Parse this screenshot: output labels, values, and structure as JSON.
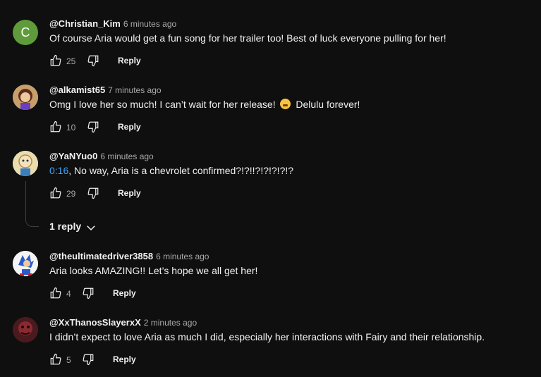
{
  "colors": {
    "background": "#0f0f0f",
    "text": "#f1f1f1",
    "muted": "#aaaaaa",
    "timestamp_link": "#3ea6ff"
  },
  "comments": [
    {
      "author": "@Christian_Kim",
      "time": "6 minutes ago",
      "avatar_letter": "C",
      "text": "Of course Aria would get a fun song for her trailer too! Best of luck everyone pulling for her!",
      "likes": "25",
      "reply_label": "Reply"
    },
    {
      "author": "@alkamist65",
      "time": "7 minutes ago",
      "text_before": "Omg I love her so much! I can’t wait for her release!",
      "emoji": "loudly-crying-face",
      "text_after": "Delulu forever!",
      "likes": "10",
      "reply_label": "Reply"
    },
    {
      "author": "@YaNYuo0",
      "time": "6 minutes ago",
      "timestamp": "0:16",
      "text": ", No way, Aria is a chevrolet confirmed?!?!!?!?!?!?!?",
      "likes": "29",
      "reply_label": "Reply",
      "replies_toggle": "1 reply"
    },
    {
      "author": "@theultimatedriver3858",
      "time": "6 minutes ago",
      "text": "Aria looks AMAZING!! Let’s hope we all get her!",
      "likes": "4",
      "reply_label": "Reply"
    },
    {
      "author": "@XxThanosSlayerxX",
      "time": "2 minutes ago",
      "text": "I didn’t expect to love Aria as much I did, especially her interactions with Fairy and their relationship.",
      "likes": "5",
      "reply_label": "Reply"
    }
  ]
}
